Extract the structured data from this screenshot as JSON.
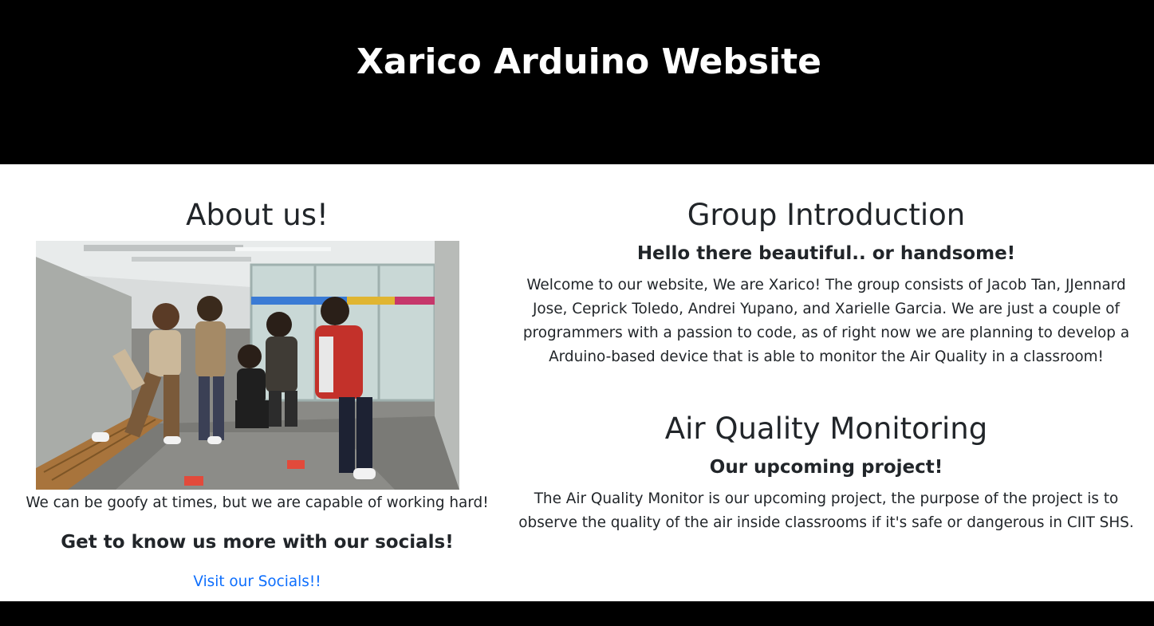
{
  "header": {
    "title": "Xarico Arduino Website",
    "background": "#000000"
  },
  "about": {
    "title": "About us!",
    "photo_alt": "Group photo of five team members posing in a hallway",
    "caption": "We can be goofy at times, but we are capable of working hard!",
    "socials_heading": "Get to know us more with our socials!",
    "socials_link": "Visit our Socials!!"
  },
  "group_intro": {
    "title": "Group Introduction",
    "subtitle": "Hello there beautiful.. or handsome!",
    "text": "Welcome to our website, We are Xarico! The group consists of Jacob Tan, JJennard Jose, Ceprick Toledo, Andrei Yupano, and Xarielle Garcia. We are just a couple of programmers with a passion to code, as of right now we are planning to develop a Arduino-based device that is able to monitor the Air Quality in a classroom!"
  },
  "air_quality": {
    "title": "Air Quality Monitoring",
    "subtitle": "Our upcoming project!",
    "text": "The Air Quality Monitor is our upcoming project, the purpose of the project is to observe the quality of the air inside classrooms if it's safe or dangerous in CIIT SHS."
  },
  "colors": {
    "link": "#0d6efd",
    "text": "#212529",
    "header_bg": "#000000",
    "footer_bg": "#000000"
  }
}
